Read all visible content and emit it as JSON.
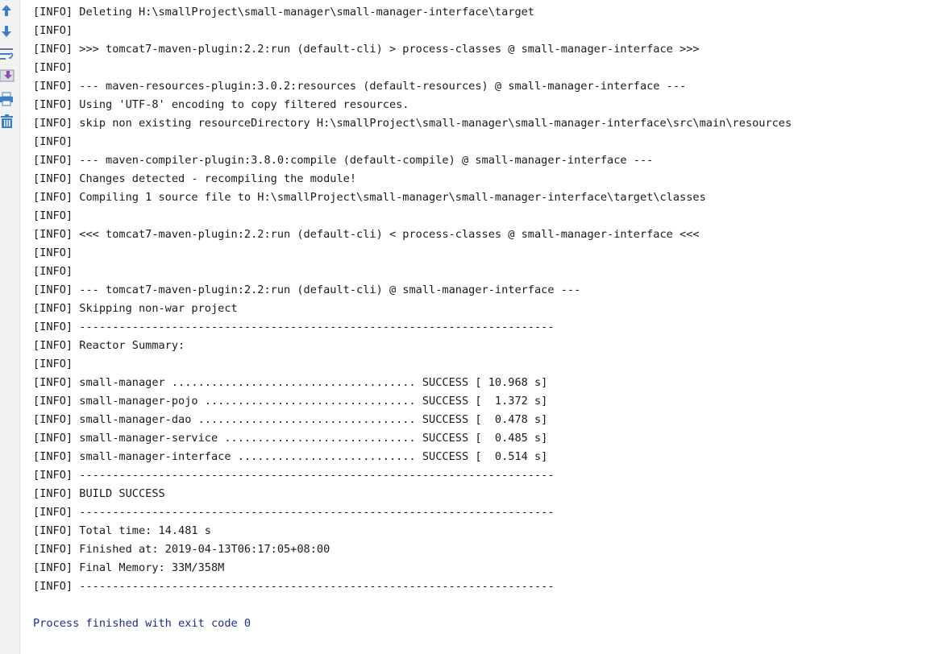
{
  "toolbar": {
    "icons": [
      "up-arrow-icon",
      "down-arrow-icon",
      "soft-wrap-icon",
      "scroll-to-end-icon",
      "print-icon",
      "clear-all-icon"
    ]
  },
  "console": {
    "lines": [
      "[INFO] Deleting H:\\smallProject\\small-manager\\small-manager-interface\\target",
      "[INFO]",
      "[INFO] >>> tomcat7-maven-plugin:2.2:run (default-cli) > process-classes @ small-manager-interface >>>",
      "[INFO]",
      "[INFO] --- maven-resources-plugin:3.0.2:resources (default-resources) @ small-manager-interface ---",
      "[INFO] Using 'UTF-8' encoding to copy filtered resources.",
      "[INFO] skip non existing resourceDirectory H:\\smallProject\\small-manager\\small-manager-interface\\src\\main\\resources",
      "[INFO]",
      "[INFO] --- maven-compiler-plugin:3.8.0:compile (default-compile) @ small-manager-interface ---",
      "[INFO] Changes detected - recompiling the module!",
      "[INFO] Compiling 1 source file to H:\\smallProject\\small-manager\\small-manager-interface\\target\\classes",
      "[INFO]",
      "[INFO] <<< tomcat7-maven-plugin:2.2:run (default-cli) < process-classes @ small-manager-interface <<<",
      "[INFO]",
      "[INFO]",
      "[INFO] --- tomcat7-maven-plugin:2.2:run (default-cli) @ small-manager-interface ---",
      "[INFO] Skipping non-war project",
      "[INFO] ------------------------------------------------------------------------",
      "[INFO] Reactor Summary:",
      "[INFO]",
      "[INFO] small-manager ..................................... SUCCESS [ 10.968 s]",
      "[INFO] small-manager-pojo ................................ SUCCESS [  1.372 s]",
      "[INFO] small-manager-dao ................................. SUCCESS [  0.478 s]",
      "[INFO] small-manager-service ............................. SUCCESS [  0.485 s]",
      "[INFO] small-manager-interface ........................... SUCCESS [  0.514 s]",
      "[INFO] ------------------------------------------------------------------------",
      "[INFO] BUILD SUCCESS",
      "[INFO] ------------------------------------------------------------------------",
      "[INFO] Total time: 14.481 s",
      "[INFO] Finished at: 2019-04-13T06:17:05+08:00",
      "[INFO] Final Memory: 33M/358M",
      "[INFO] ------------------------------------------------------------------------",
      "",
      "Process finished with exit code 0"
    ]
  },
  "colors": {
    "text": "#1a1a1a",
    "exit_text": "#1c2d8a",
    "toolbar_bg": "#f2f2f2",
    "icon_blue": "#3c7fc8"
  }
}
